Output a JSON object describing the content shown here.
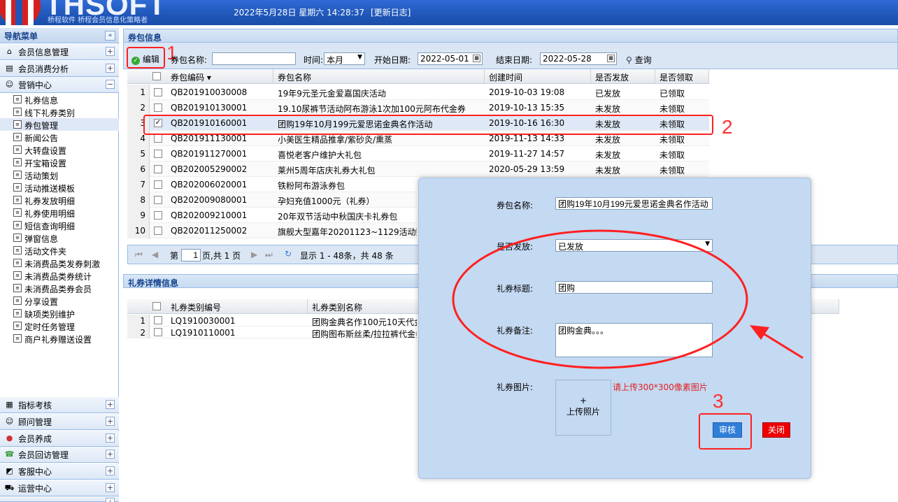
{
  "header": {
    "logo": "THSOFT",
    "logo_sub": "桥程软件  桥程会员信息化策略者",
    "datetime": "2022年5月28日 星期六 14:28:37",
    "changelog": "[更新日志]"
  },
  "sidebar": {
    "title": "导航菜单",
    "collapse": "«",
    "sections_top": [
      {
        "label": "会员信息管理",
        "toggle": "+",
        "icon": "home-icon"
      },
      {
        "label": "会员消费分析",
        "toggle": "+",
        "icon": "report-icon"
      },
      {
        "label": "营销中心",
        "toggle": "−",
        "icon": "people-icon"
      }
    ],
    "items": [
      "礼券信息",
      "线下礼券类别",
      "券包管理",
      "新闻公告",
      "大转盘设置",
      "开宝箱设置",
      "活动策划",
      "活动推送模板",
      "礼券发放明细",
      "礼券使用明细",
      "短信查询明细",
      "弹窗信息",
      "活动文件夹",
      "未消费品类发券刺激",
      "未消费品类券统计",
      "未消费品类券会员",
      "分享设置",
      "缺项类别维护",
      "定时任务管理",
      "商户礼券赠送设置"
    ],
    "selected_index": 2,
    "sections_bottom": [
      {
        "label": "指标考核",
        "toggle": "+",
        "icon": "chart-icon"
      },
      {
        "label": "顾问管理",
        "toggle": "+",
        "icon": "user-icon"
      },
      {
        "label": "会员养成",
        "toggle": "+",
        "icon": "member-icon"
      },
      {
        "label": "会员回访管理",
        "toggle": "+",
        "icon": "phone-icon"
      },
      {
        "label": "客服中心",
        "toggle": "+",
        "icon": "service-icon"
      },
      {
        "label": "运营中心",
        "toggle": "+",
        "icon": "cart-icon"
      },
      {
        "label": "",
        "toggle": "+",
        "icon": "misc-icon"
      }
    ]
  },
  "pack": {
    "title": "券包信息",
    "toolbar": {
      "edit": "编辑",
      "name_label": "券包名称:",
      "name_value": "",
      "time_label": "时间:",
      "time_value": "本月",
      "start_label": "开始日期:",
      "start_value": "2022-05-01",
      "end_label": "结束日期:",
      "end_value": "2022-05-28",
      "search": "查询"
    },
    "columns": [
      "券包编码 ▾",
      "券包名称",
      "创建时间",
      "是否发放",
      "是否领取"
    ],
    "rows": [
      {
        "n": "1",
        "code": "QB201910030008",
        "name": "19年9元圣元金爱嘉国庆活动",
        "time": "2019-10-03 19:08",
        "issued": "已发放",
        "got": "已领取",
        "checked": false
      },
      {
        "n": "2",
        "code": "QB201910130001",
        "name": "19.10尿裤节活动阿布游泳1次加100元阿布代金券",
        "time": "2019-10-13 15:35",
        "issued": "未发放",
        "got": "未领取",
        "checked": false
      },
      {
        "n": "3",
        "code": "QB201910160001",
        "name": "团购19年10月199元爱思诺金典名作活动",
        "time": "2019-10-16 16:30",
        "issued": "未发放",
        "got": "未领取",
        "checked": true
      },
      {
        "n": "4",
        "code": "QB201911130001",
        "name": "小美医生精品推拿/紫砂灸/熏蒸",
        "time": "2019-11-13 14:33",
        "issued": "未发放",
        "got": "未领取",
        "checked": false
      },
      {
        "n": "5",
        "code": "QB201911270001",
        "name": "喜悦老客户维护大礼包",
        "time": "2019-11-27 14:57",
        "issued": "未发放",
        "got": "未领取",
        "checked": false
      },
      {
        "n": "6",
        "code": "QB202005290002",
        "name": "莱州5周年店庆礼券大礼包",
        "time": "2020-05-29 13:59",
        "issued": "未发放",
        "got": "未领取",
        "checked": false
      },
      {
        "n": "7",
        "code": "QB202006020001",
        "name": "铁粉阿布游泳券包",
        "time": "",
        "issued": "",
        "got": "",
        "checked": false
      },
      {
        "n": "8",
        "code": "QB202009080001",
        "name": "孕妇充值1000元（礼券）",
        "time": "",
        "issued": "",
        "got": "",
        "checked": false
      },
      {
        "n": "9",
        "code": "QB202009210001",
        "name": "20年双节活动中秋国庆卡礼券包",
        "time": "",
        "issued": "",
        "got": "",
        "checked": false
      },
      {
        "n": "10",
        "code": "QB202011250002",
        "name": "旗舰大型嘉年20201123~1129活动赠券",
        "time": "",
        "issued": "",
        "got": "",
        "checked": false
      }
    ],
    "pager": {
      "page_prefix": "第",
      "page_value": "1",
      "page_suffix": "页,共 1 页",
      "info": "显示 1 - 48条，共 48 条"
    }
  },
  "detail": {
    "title": "礼券详情信息",
    "columns": [
      "礼券类别编号",
      "礼券类别名称"
    ],
    "rows": [
      {
        "n": "1",
        "code": "LQ1910030001",
        "name": "团购金典名作100元10天代金券"
      },
      {
        "n": "2",
        "code": "LQ1910110001",
        "name": "团购图布斯丝柔/拉拉裤代金券"
      }
    ]
  },
  "dialog": {
    "name_label": "券包名称:",
    "name_value": "团购19年10月199元爱思诺金典名作活动",
    "issued_label": "是否发放:",
    "issued_value": "已发放",
    "title_label": "礼券标题:",
    "title_value": "团购",
    "remark_label": "礼券备注:",
    "remark_value": "团购金典。。。",
    "image_label": "礼券图片:",
    "upload_plus": "+",
    "upload_text": "上传照片",
    "image_hint": "请上传300*300像素图片",
    "audit": "审核",
    "close": "关闭"
  },
  "annotations": {
    "n1": "1",
    "n2": "2",
    "n3": "3"
  },
  "colors": {
    "header": "#1f56b8",
    "panel_border": "#99bbe8",
    "annotation": "#ff2020",
    "dialog_bg": "#c4d9f2",
    "audit": "#2f7fd8",
    "close": "#ee0000"
  }
}
